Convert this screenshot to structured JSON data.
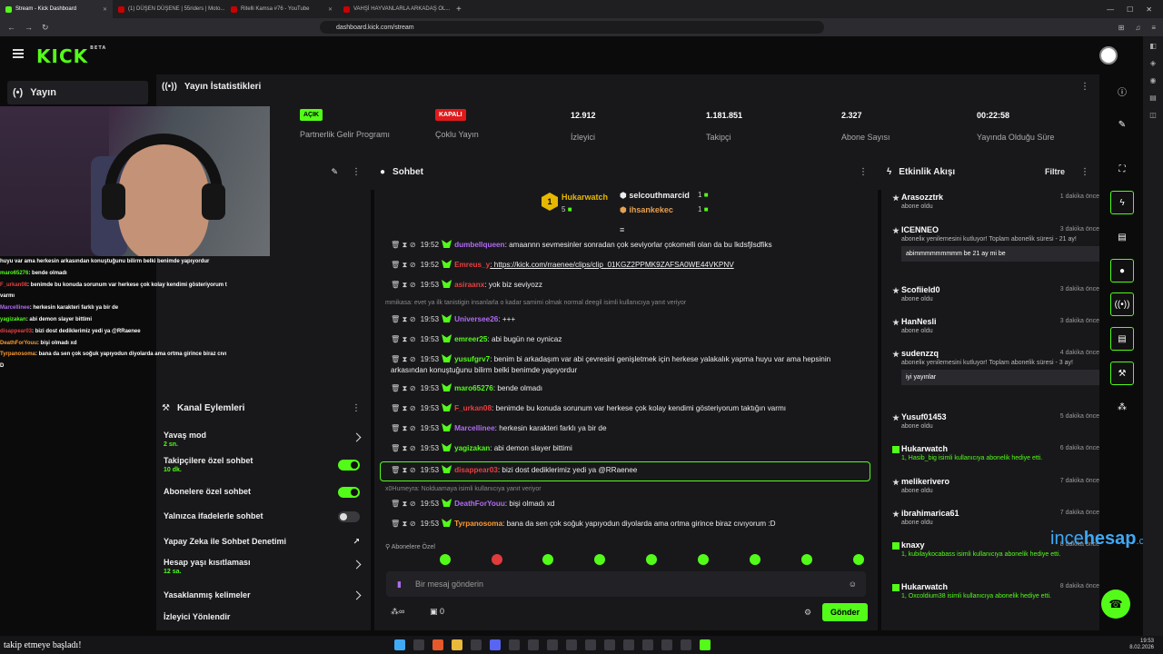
{
  "browser": {
    "tabs": [
      {
        "title": "Stream - Kick Dashboard",
        "active": true
      },
      {
        "title": "(1) DÜŞEN DÜŞENE | 55riders | Moto..."
      },
      {
        "title": "Ritelli Kamsa #76 - YouTube"
      },
      {
        "title": "VAHŞİ HAYVANLARLA ARKADAŞ OL..."
      }
    ],
    "new_tab": "+",
    "url": "dashboard.kick.com/stream"
  },
  "taskbar": {
    "notification_user": "",
    "notification_text": "takip etmeye başladı!",
    "time": "19:53",
    "date": "8.02.2026"
  },
  "app": {
    "logo": "KICK",
    "logo_tag": "BETA",
    "sidebar_item": "Yayın"
  },
  "stats": {
    "title": "Yayın İstatistikleri",
    "items": [
      {
        "badge": "AÇIK",
        "label": "Partnerlik Gelir Programı"
      },
      {
        "badge": "KAPALI",
        "label": "Çoklu Yayın"
      },
      {
        "value": "12.912",
        "label": "İzleyici"
      },
      {
        "value": "1.181.851",
        "label": "Takipçi"
      },
      {
        "value": "2.327",
        "label": "Abone Sayısı"
      },
      {
        "value": "00:22:58",
        "label": "Yayında Olduğu Süre"
      }
    ]
  },
  "overlay_chat": [
    {
      "user": "huyu var ama herkesin arkasından konuştuğunu bilirm belki benimde yapıyordur",
      "color": "#fff",
      "text": ""
    },
    {
      "user": "maro65276",
      "color": "#53fc18",
      "text": ": bende olmadı"
    },
    {
      "user": "F_urkan08",
      "color": "#e83f3f",
      "text": ": benimde bu konuda sorunum var herkese çok kolay kendimi gösteriyorum t"
    },
    {
      "user": "varmı",
      "color": "#fff",
      "text": ""
    },
    {
      "user": "Marcellinee",
      "color": "#b06cf0",
      "text": ": herkesin karakteri farklı ya bir de"
    },
    {
      "user": "yagizakan",
      "color": "#53fc18",
      "text": ": abi demon slayer bittimi"
    },
    {
      "user": "disappear03",
      "color": "#e83f3f",
      "text": ": bizi dost dediklerimiz yedi ya @RRaenee"
    },
    {
      "user": "DeathForYouu",
      "color": "#ff9a2e",
      "text": ": bişi olmadı xd"
    },
    {
      "user": "Tyrpanosoma",
      "color": "#ff9a2e",
      "text": ": bana da sen çok soğuk yapıyodun diyolarda ama ortma girince biraz cıvı"
    },
    {
      "user": "D",
      "color": "#fff",
      "text": ""
    }
  ],
  "actions": {
    "title": "Kanal Eylemleri",
    "rows": [
      {
        "label": "Yavaş mod",
        "sub": "2 sn.",
        "control": "chevron"
      },
      {
        "label": "Takipçilere özel sohbet",
        "sub": "10 dk.",
        "control": "toggle-on"
      },
      {
        "label": "Abonelere özel sohbet",
        "sub": "",
        "control": "toggle-on"
      },
      {
        "label": "Yalnızca ifadelerle sohbet",
        "sub": "",
        "control": "toggle-off"
      },
      {
        "label": "Yapay Zeka ile Sohbet Denetimi",
        "sub": "",
        "control": "external"
      },
      {
        "label": "Hesap yaşı kısıtlaması",
        "sub": "12 sa.",
        "control": "chevron"
      },
      {
        "label": "Yasaklanmış kelimeler",
        "sub": "",
        "control": "chevron"
      },
      {
        "label": "İzleyici Yönlendir",
        "sub": "",
        "control": "none"
      }
    ]
  },
  "chat": {
    "title": "Sohbet",
    "leaderboard": [
      {
        "rank": "1",
        "name": "Hukarwatch",
        "count": "5"
      },
      {
        "name": "selcouthmarcid",
        "count": "1"
      },
      {
        "name": "ihsankekec",
        "count": "1"
      }
    ],
    "messages": [
      {
        "time": "19:52",
        "user": "dumbellqueen",
        "color": "#b06cf0",
        "text": ": amaannn sevmesinler sonradan çok seviyorlar çokomelli olan da bu lkdsfjlsdfiks"
      },
      {
        "time": "19:52",
        "user": "Emreus_y",
        "color": "#e83f3f",
        "text": ": https://kick.com/rraenee/clips/clip_01KGZ2PPMK9ZAFSA0WE44VKPNV"
      },
      {
        "time": "19:53",
        "user": "asiraanx",
        "color": "#e83f3f",
        "text": ": yok biz seviyozz"
      },
      {
        "reply": "mmikasa: evet ya ilk tanistigin insanlarla o kadar samimi olmak normal deegil isimli kullanıcıya yanıt veriyor"
      },
      {
        "time": "19:53",
        "user": "Universee26",
        "color": "#b06cf0",
        "text": ": +++"
      },
      {
        "time": "19:53",
        "user": "emreer25",
        "color": "#53fc18",
        "text": ": abi bugün ne oynicaz"
      },
      {
        "time": "19:53",
        "user": "yusufgrv7",
        "color": "#53fc18",
        "text": ": benim bi arkadaşım var abi çevresini genişletmek için herkese yalakalık yapma huyu var ama hepsinin arkasından konuştuğunu bilirm belki benimde yapıyordur"
      },
      {
        "time": "19:53",
        "user": "maro65276",
        "color": "#53fc18",
        "text": ": bende olmadı"
      },
      {
        "time": "19:53",
        "user": "F_urkan08",
        "color": "#e83f3f",
        "text": ": benimde bu konuda sorunum var herkese çok kolay kendimi gösteriyorum taktığın varmı"
      },
      {
        "time": "19:53",
        "user": "Marcellinee",
        "color": "#b06cf0",
        "text": ": herkesin karakteri farklı ya bir de"
      },
      {
        "time": "19:53",
        "user": "yagizakan",
        "color": "#53fc18",
        "text": ": abi demon slayer bittimi"
      },
      {
        "time": "19:53",
        "user": "disappear03",
        "color": "#e83f3f",
        "text": ": bizi dost dediklerimiz yedi ya @RRaenee"
      },
      {
        "reply": "x0Humeyra: Nolduamaya isimli kullanıcıya yanıt veriyor"
      },
      {
        "time": "19:53",
        "user": "DeathForYouu",
        "color": "#b06cf0",
        "text": ": bişi olmadı xd"
      },
      {
        "time": "19:53",
        "user": "Tyrpanosoma",
        "color": "#ff9a2e",
        "text": ": bana da sen çok soğuk yapıyodun diyolarda ama ortma girince biraz cıvıyorum :D"
      }
    ],
    "sub_only_label": "Abonelere Özel",
    "input_placeholder": "Bir mesaj gönderin",
    "points": "0",
    "send_label": "Gönder"
  },
  "activity": {
    "title": "Etkinlik Akışı",
    "filter": "Filtre",
    "items": [
      {
        "name": "Arasozztrk",
        "desc": "abone oldu",
        "ago": "1 dakika önce",
        "icon": "star"
      },
      {
        "name": "ICENNEO",
        "desc": "aboneliк yenilemesini kutluyor! Toplam abonelik süresi - 21 ay!",
        "ago": "3 dakika önce",
        "msg": "abimmmmmmmmm be 21 ay mi be",
        "icon": "star"
      },
      {
        "name": "Scofiield0",
        "desc": "abone oldu",
        "ago": "3 dakika önce",
        "icon": "star"
      },
      {
        "name": "HanNesli",
        "desc": "abone oldu",
        "ago": "3 dakika önce",
        "icon": "star"
      },
      {
        "name": "sudenzzq",
        "desc": "aboneliк yenilemesini kutluyor! Toplam abonelik süresi - 3 ay!",
        "ago": "4 dakika önce",
        "msg": "iyi yayınlar",
        "icon": "star"
      },
      {
        "name": "Yusuf01453",
        "desc": "abone oldu",
        "ago": "5 dakika önce",
        "icon": "star"
      },
      {
        "name": "Hukarwatch",
        "desc": "1, Hasib_big isimli kullanıcıya abonelik hediye etti.",
        "ago": "6 dakika önce",
        "icon": "gift"
      },
      {
        "name": "melikerivero",
        "desc": "abone oldu",
        "ago": "7 dakika önce",
        "icon": "star"
      },
      {
        "name": "ibrahimarica61",
        "desc": "abone oldu",
        "ago": "7 dakika önce",
        "icon": "star"
      },
      {
        "name": "knaxy",
        "desc": "1, kubilaykocabass isimli kullanıcıya abonelik hediye etti.",
        "ago": "8 dakika önce",
        "icon": "gift"
      },
      {
        "name": "Hukarwatch",
        "desc": "1, Oxcoldium38 isimli kullanıcıya abonelik hediye etti.",
        "ago": "8 dakika önce",
        "icon": "gift"
      }
    ]
  },
  "watermark": {
    "a": "ince",
    "b": "hesap",
    "c": ".com"
  },
  "colors": {
    "accent": "#53fc18",
    "panel": "#18181b",
    "bg": "#0b0b0c"
  }
}
